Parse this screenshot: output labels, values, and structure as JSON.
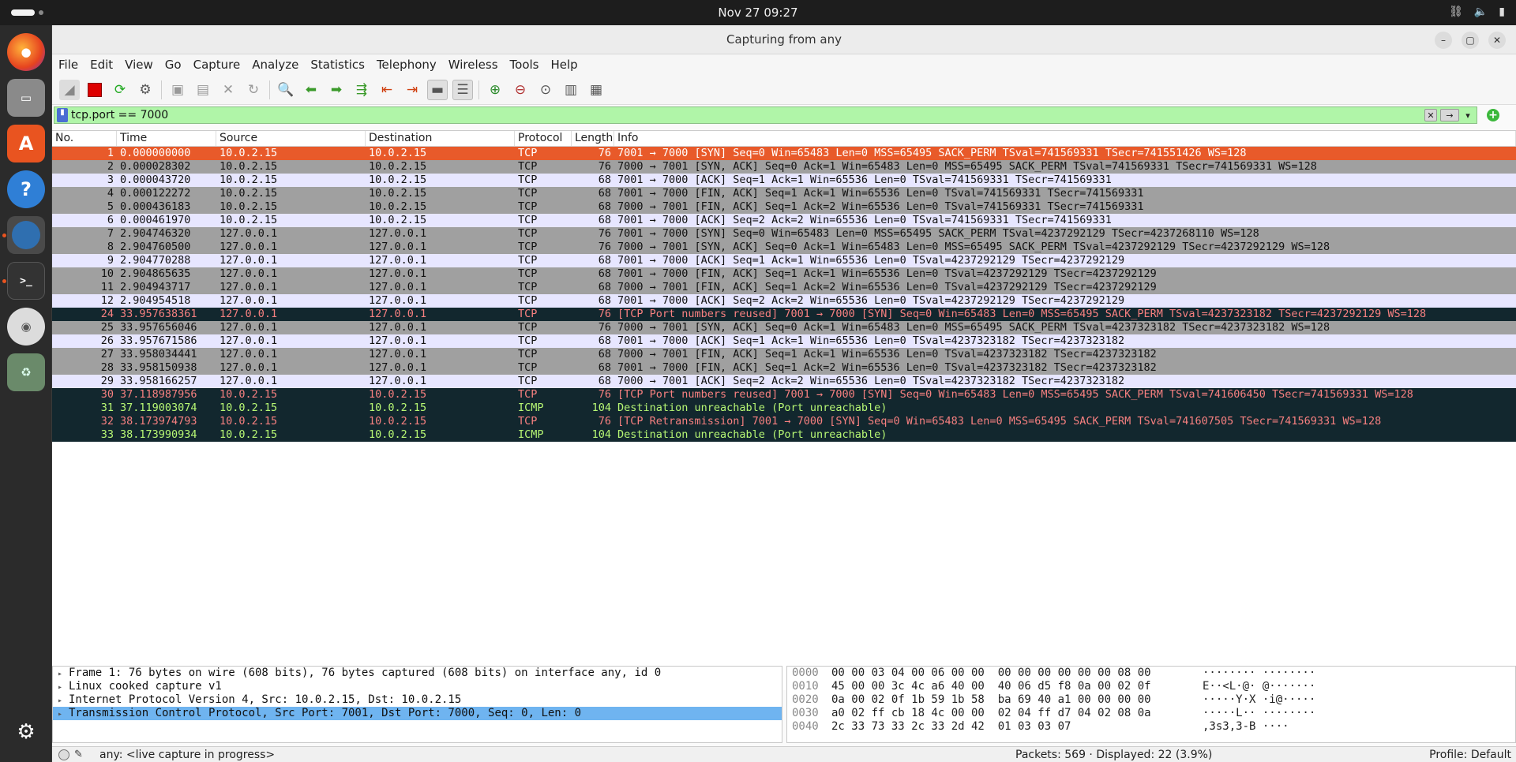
{
  "system": {
    "clock": "Nov 27  09:27",
    "tray_icons": [
      "network-icon",
      "volume-icon",
      "battery-icon"
    ]
  },
  "dock": {
    "items": [
      "firefox-icon",
      "files-icon",
      "app-center-icon",
      "help-icon",
      "wireshark-icon",
      "terminal-icon",
      "disc-icon",
      "trash-icon",
      "show-apps-icon"
    ]
  },
  "window": {
    "title": "Capturing from any"
  },
  "menu": [
    "File",
    "Edit",
    "View",
    "Go",
    "Capture",
    "Analyze",
    "Statistics",
    "Telephony",
    "Wireless",
    "Tools",
    "Help"
  ],
  "filter": {
    "value": "tcp.port == 7000"
  },
  "columns": [
    "No.",
    "Time",
    "Source",
    "Destination",
    "Protocol",
    "Length",
    "Info"
  ],
  "packets": [
    {
      "no": "1",
      "time": "0.000000000",
      "src": "10.0.2.15",
      "dst": "10.0.2.15",
      "proto": "TCP",
      "len": "76",
      "info": "7001 → 7000 [SYN] Seq=0 Win=65483 Len=0 MSS=65495 SACK_PERM TSval=741569331 TSecr=741551426 WS=128",
      "style": "sel"
    },
    {
      "no": "2",
      "time": "0.000028302",
      "src": "10.0.2.15",
      "dst": "10.0.2.15",
      "proto": "TCP",
      "len": "76",
      "info": "7000 → 7001 [SYN, ACK] Seq=0 Ack=1 Win=65483 Len=0 MSS=65495 SACK_PERM TSval=741569331 TSecr=741569331 WS=128",
      "style": "gray"
    },
    {
      "no": "3",
      "time": "0.000043720",
      "src": "10.0.2.15",
      "dst": "10.0.2.15",
      "proto": "TCP",
      "len": "68",
      "info": "7001 → 7000 [ACK] Seq=1 Ack=1 Win=65536 Len=0 TSval=741569331 TSecr=741569331",
      "style": "lav"
    },
    {
      "no": "4",
      "time": "0.000122272",
      "src": "10.0.2.15",
      "dst": "10.0.2.15",
      "proto": "TCP",
      "len": "68",
      "info": "7001 → 7000 [FIN, ACK] Seq=1 Ack=1 Win=65536 Len=0 TSval=741569331 TSecr=741569331",
      "style": "gray"
    },
    {
      "no": "5",
      "time": "0.000436183",
      "src": "10.0.2.15",
      "dst": "10.0.2.15",
      "proto": "TCP",
      "len": "68",
      "info": "7000 → 7001 [FIN, ACK] Seq=1 Ack=2 Win=65536 Len=0 TSval=741569331 TSecr=741569331",
      "style": "gray"
    },
    {
      "no": "6",
      "time": "0.000461970",
      "src": "10.0.2.15",
      "dst": "10.0.2.15",
      "proto": "TCP",
      "len": "68",
      "info": "7001 → 7000 [ACK] Seq=2 Ack=2 Win=65536 Len=0 TSval=741569331 TSecr=741569331",
      "style": "lav"
    },
    {
      "no": "7",
      "time": "2.904746320",
      "src": "127.0.0.1",
      "dst": "127.0.0.1",
      "proto": "TCP",
      "len": "76",
      "info": "7001 → 7000 [SYN] Seq=0 Win=65483 Len=0 MSS=65495 SACK_PERM TSval=4237292129 TSecr=4237268110 WS=128",
      "style": "gray"
    },
    {
      "no": "8",
      "time": "2.904760500",
      "src": "127.0.0.1",
      "dst": "127.0.0.1",
      "proto": "TCP",
      "len": "76",
      "info": "7000 → 7001 [SYN, ACK] Seq=0 Ack=1 Win=65483 Len=0 MSS=65495 SACK_PERM TSval=4237292129 TSecr=4237292129 WS=128",
      "style": "gray"
    },
    {
      "no": "9",
      "time": "2.904770288",
      "src": "127.0.0.1",
      "dst": "127.0.0.1",
      "proto": "TCP",
      "len": "68",
      "info": "7001 → 7000 [ACK] Seq=1 Ack=1 Win=65536 Len=0 TSval=4237292129 TSecr=4237292129",
      "style": "lav"
    },
    {
      "no": "10",
      "time": "2.904865635",
      "src": "127.0.0.1",
      "dst": "127.0.0.1",
      "proto": "TCP",
      "len": "68",
      "info": "7001 → 7000 [FIN, ACK] Seq=1 Ack=1 Win=65536 Len=0 TSval=4237292129 TSecr=4237292129",
      "style": "gray"
    },
    {
      "no": "11",
      "time": "2.904943717",
      "src": "127.0.0.1",
      "dst": "127.0.0.1",
      "proto": "TCP",
      "len": "68",
      "info": "7000 → 7001 [FIN, ACK] Seq=1 Ack=2 Win=65536 Len=0 TSval=4237292129 TSecr=4237292129",
      "style": "gray"
    },
    {
      "no": "12",
      "time": "2.904954518",
      "src": "127.0.0.1",
      "dst": "127.0.0.1",
      "proto": "TCP",
      "len": "68",
      "info": "7001 → 7000 [ACK] Seq=2 Ack=2 Win=65536 Len=0 TSval=4237292129 TSecr=4237292129",
      "style": "lav"
    },
    {
      "no": "24",
      "time": "33.957638361",
      "src": "127.0.0.1",
      "dst": "127.0.0.1",
      "proto": "TCP",
      "len": "76",
      "info": "[TCP Port numbers reused] 7001 → 7000 [SYN] Seq=0 Win=65483 Len=0 MSS=65495 SACK_PERM TSval=4237323182 TSecr=4237292129 WS=128",
      "style": "black"
    },
    {
      "no": "25",
      "time": "33.957656046",
      "src": "127.0.0.1",
      "dst": "127.0.0.1",
      "proto": "TCP",
      "len": "76",
      "info": "7000 → 7001 [SYN, ACK] Seq=0 Ack=1 Win=65483 Len=0 MSS=65495 SACK_PERM TSval=4237323182 TSecr=4237323182 WS=128",
      "style": "gray"
    },
    {
      "no": "26",
      "time": "33.957671586",
      "src": "127.0.0.1",
      "dst": "127.0.0.1",
      "proto": "TCP",
      "len": "68",
      "info": "7001 → 7000 [ACK] Seq=1 Ack=1 Win=65536 Len=0 TSval=4237323182 TSecr=4237323182",
      "style": "lav"
    },
    {
      "no": "27",
      "time": "33.958034441",
      "src": "127.0.0.1",
      "dst": "127.0.0.1",
      "proto": "TCP",
      "len": "68",
      "info": "7000 → 7001 [FIN, ACK] Seq=1 Ack=1 Win=65536 Len=0 TSval=4237323182 TSecr=4237323182",
      "style": "gray"
    },
    {
      "no": "28",
      "time": "33.958150938",
      "src": "127.0.0.1",
      "dst": "127.0.0.1",
      "proto": "TCP",
      "len": "68",
      "info": "7001 → 7000 [FIN, ACK] Seq=1 Ack=2 Win=65536 Len=0 TSval=4237323182 TSecr=4237323182",
      "style": "gray"
    },
    {
      "no": "29",
      "time": "33.958166257",
      "src": "127.0.0.1",
      "dst": "127.0.0.1",
      "proto": "TCP",
      "len": "68",
      "info": "7000 → 7001 [ACK] Seq=2 Ack=2 Win=65536 Len=0 TSval=4237323182 TSecr=4237323182",
      "style": "lav"
    },
    {
      "no": "30",
      "time": "37.118987956",
      "src": "10.0.2.15",
      "dst": "10.0.2.15",
      "proto": "TCP",
      "len": "76",
      "info": "[TCP Port numbers reused] 7001 → 7000 [SYN] Seq=0 Win=65483 Len=0 MSS=65495 SACK_PERM TSval=741606450 TSecr=741569331 WS=128",
      "style": "black"
    },
    {
      "no": "31",
      "time": "37.119003074",
      "src": "10.0.2.15",
      "dst": "10.0.2.15",
      "proto": "ICMP",
      "len": "104",
      "info": "Destination unreachable (Port unreachable)",
      "style": "icmp"
    },
    {
      "no": "32",
      "time": "38.173974793",
      "src": "10.0.2.15",
      "dst": "10.0.2.15",
      "proto": "TCP",
      "len": "76",
      "info": "[TCP Retransmission] 7001 → 7000 [SYN] Seq=0 Win=65483 Len=0 MSS=65495 SACK_PERM TSval=741607505 TSecr=741569331 WS=128",
      "style": "black"
    },
    {
      "no": "33",
      "time": "38.173990934",
      "src": "10.0.2.15",
      "dst": "10.0.2.15",
      "proto": "ICMP",
      "len": "104",
      "info": "Destination unreachable (Port unreachable)",
      "style": "icmp"
    }
  ],
  "details": [
    {
      "text": "Frame 1: 76 bytes on wire (608 bits), 76 bytes captured (608 bits) on interface any, id 0",
      "selected": false
    },
    {
      "text": "Linux cooked capture v1",
      "selected": false
    },
    {
      "text": "Internet Protocol Version 4, Src: 10.0.2.15, Dst: 10.0.2.15",
      "selected": false
    },
    {
      "text": "Transmission Control Protocol, Src Port: 7001, Dst Port: 7000, Seq: 0, Len: 0",
      "selected": true
    }
  ],
  "hex": [
    {
      "off": "0000",
      "bytes": "00 00 03 04 00 06 00 00  00 00 00 00 00 00 08 00",
      "ascii": "········ ········"
    },
    {
      "off": "0010",
      "bytes": "45 00 00 3c 4c a6 40 00  40 06 d5 f8 0a 00 02 0f",
      "ascii": "E··<L·@· @·······"
    },
    {
      "off": "0020",
      "bytes": "0a 00 02 0f 1b 59 1b 58  ba 69 40 a1 00 00 00 00",
      "ascii": "·····Y·X ·i@·····"
    },
    {
      "off": "0030",
      "bytes": "a0 02 ff cb 18 4c 00 00  02 04 ff d7 04 02 08 0a",
      "ascii": "·····L·· ········"
    },
    {
      "off": "0040",
      "bytes": "2c 33 73 33 2c 33 2d 42  01 03 03 07",
      "ascii": ",3s3,3-B ····"
    }
  ],
  "status": {
    "capture": "any: <live capture in progress>",
    "packets": "Packets: 569 · Displayed: 22 (3.9%)",
    "profile": "Profile: Default"
  }
}
